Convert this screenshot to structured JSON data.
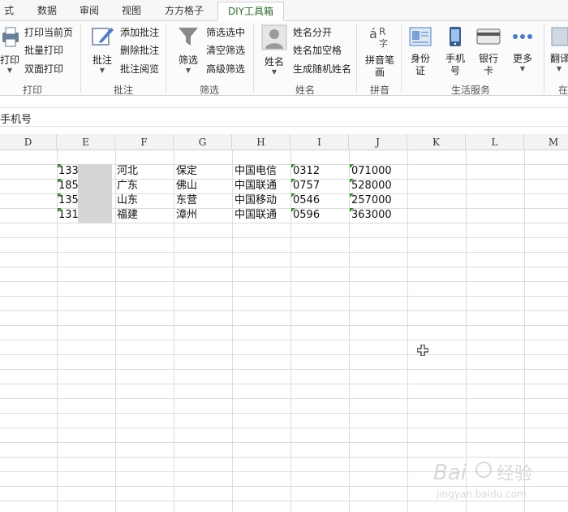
{
  "tabs": [
    {
      "label": "式"
    },
    {
      "label": "数据"
    },
    {
      "label": "审阅"
    },
    {
      "label": "视图"
    },
    {
      "label": "方方格子"
    },
    {
      "label": "DIY工具箱"
    }
  ],
  "ribbon": {
    "print": {
      "big_label": "打印",
      "items": [
        "打印当前页",
        "批量打印",
        "双面打印"
      ],
      "group": "打印"
    },
    "comment": {
      "big_label": "批注",
      "items": [
        "添加批注",
        "删除批注",
        "批注阅览"
      ],
      "group": "批注"
    },
    "filter": {
      "big_label": "筛选",
      "items": [
        "筛选选中",
        "清空筛选",
        "高级筛选"
      ],
      "group": "筛选"
    },
    "name": {
      "big_label": "姓名",
      "items": [
        "姓名分开",
        "姓名加空格",
        "生成随机姓名"
      ],
      "group": "姓名"
    },
    "pinyin": {
      "big_label_1": "拼音笔",
      "big_label_2": "画",
      "group": "拼音"
    },
    "life": {
      "id_card_1": "身份",
      "id_card_2": "证",
      "phone_1": "手机",
      "phone_2": "号",
      "bank_1": "银行",
      "bank_2": "卡",
      "more": "更多",
      "group": "生活服务"
    },
    "translate": {
      "big_label": "翻译",
      "group": "在"
    }
  },
  "formula_bar": {
    "text": "手机号"
  },
  "columns": [
    "D",
    "E",
    "F",
    "G",
    "H",
    "I",
    "J",
    "K",
    "L",
    "M"
  ],
  "rows": [
    {
      "phone": "133",
      "province": "河北",
      "city": "保定",
      "carrier": "中国电信",
      "area_code": "0312",
      "postcode": "071000"
    },
    {
      "phone": "185",
      "province": "广东",
      "city": "佛山",
      "carrier": "中国联通",
      "area_code": "0757",
      "postcode": "528000"
    },
    {
      "phone": "135",
      "province": "山东",
      "city": "东营",
      "carrier": "中国移动",
      "area_code": "0546",
      "postcode": "257000"
    },
    {
      "phone": "131",
      "province": "福建",
      "city": "漳州",
      "carrier": "中国联通",
      "area_code": "0596",
      "postcode": "363000"
    }
  ],
  "watermark": {
    "brand": "Bai",
    "brand2": "经验",
    "url": "jingyan.baidu.com"
  },
  "colors": {
    "accent": "#2e8b2e",
    "active_tab_text": "#2e6b2e"
  }
}
